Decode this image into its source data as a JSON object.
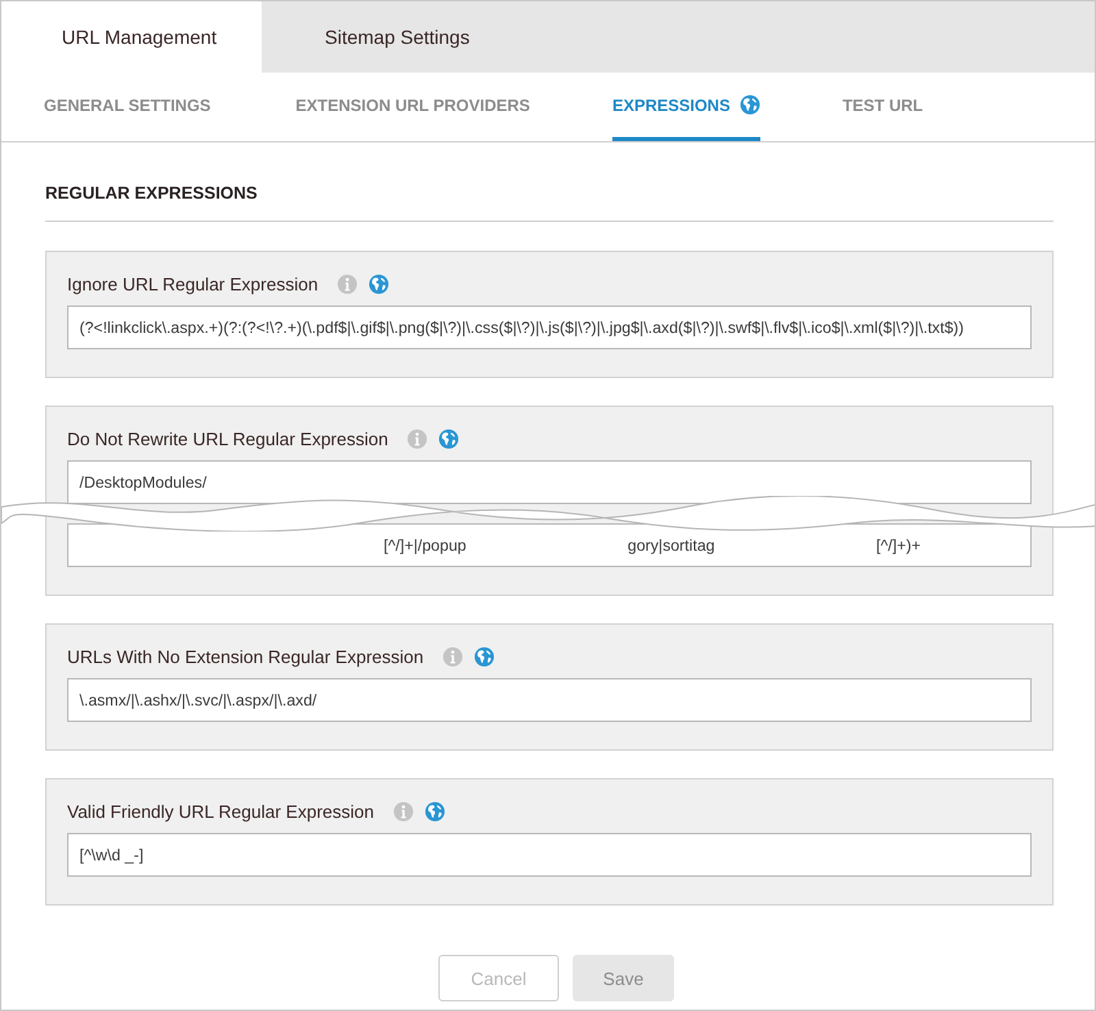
{
  "top_tabs": [
    {
      "label": "URL Management",
      "selected": true
    },
    {
      "label": "Sitemap Settings",
      "selected": false
    }
  ],
  "sub_tabs": [
    {
      "label": "GENERAL SETTINGS",
      "selected": false,
      "globe": false
    },
    {
      "label": "EXTENSION URL PROVIDERS",
      "selected": false,
      "globe": false
    },
    {
      "label": "EXPRESSIONS",
      "selected": true,
      "globe": true
    },
    {
      "label": "TEST URL",
      "selected": false,
      "globe": false
    }
  ],
  "section_title": "REGULAR EXPRESSIONS",
  "expressions": [
    {
      "label": "Ignore URL Regular Expression",
      "value": "(?<!linkclick\\.aspx.+)(?:(?<!\\?.+)(\\.pdf$|\\.gif$|\\.png($|\\?)|\\.css($|\\?)|\\.js($|\\?)|\\.jpg$|\\.axd($|\\?)|\\.swf$|\\.flv$|\\.ico$|\\.xml($|\\?)|\\.txt$))"
    },
    {
      "label": "Do Not Rewrite URL Regular Expression",
      "value": "/DesktopModules/",
      "torn_fragments": [
        "[^/]+|/popup",
        "gory|sortitag",
        "[^/]+)+"
      ]
    },
    {
      "label": "URLs With No Extension Regular Expression",
      "value": "\\.asmx/|\\.ashx/|\\.svc/|\\.aspx/|\\.axd/"
    },
    {
      "label": "Valid Friendly URL Regular Expression",
      "value": "[^\\w\\d _-]"
    }
  ],
  "buttons": [
    {
      "label": "Cancel",
      "kind": "secondary",
      "disabled": true
    },
    {
      "label": "Save",
      "kind": "primary",
      "disabled": true
    }
  ]
}
